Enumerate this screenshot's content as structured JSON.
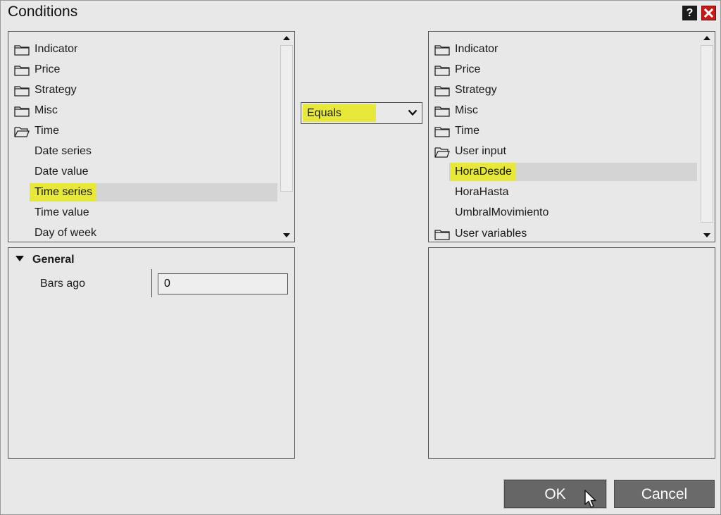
{
  "window": {
    "title": "Conditions",
    "help_label": "?",
    "close_icon": "close-icon"
  },
  "left_tree": {
    "items": [
      {
        "label": "Indicator",
        "type": "folder"
      },
      {
        "label": "Price",
        "type": "folder"
      },
      {
        "label": "Strategy",
        "type": "folder"
      },
      {
        "label": "Misc",
        "type": "folder"
      },
      {
        "label": "Time",
        "type": "folder-open"
      },
      {
        "label": "Date series",
        "type": "child"
      },
      {
        "label": "Date value",
        "type": "child"
      },
      {
        "label": "Time series",
        "type": "child",
        "selected": true
      },
      {
        "label": "Time value",
        "type": "child"
      },
      {
        "label": "Day of week",
        "type": "child"
      }
    ]
  },
  "operator": {
    "value": "Equals"
  },
  "right_tree": {
    "items": [
      {
        "label": "Indicator",
        "type": "folder"
      },
      {
        "label": "Price",
        "type": "folder"
      },
      {
        "label": "Strategy",
        "type": "folder"
      },
      {
        "label": "Misc",
        "type": "folder"
      },
      {
        "label": "Time",
        "type": "folder"
      },
      {
        "label": "User input",
        "type": "folder-open"
      },
      {
        "label": "HoraDesde",
        "type": "child",
        "selected": true
      },
      {
        "label": "HoraHasta",
        "type": "child"
      },
      {
        "label": "UmbralMovimiento",
        "type": "child"
      },
      {
        "label": "User variables",
        "type": "folder"
      }
    ]
  },
  "properties": {
    "group": "General",
    "fields": [
      {
        "label": "Bars ago",
        "value": "0"
      }
    ]
  },
  "buttons": {
    "ok": "OK",
    "cancel": "Cancel"
  },
  "colors": {
    "highlight": "#e7e83a",
    "button": "#6a6a6a",
    "close": "#c41a1a"
  }
}
